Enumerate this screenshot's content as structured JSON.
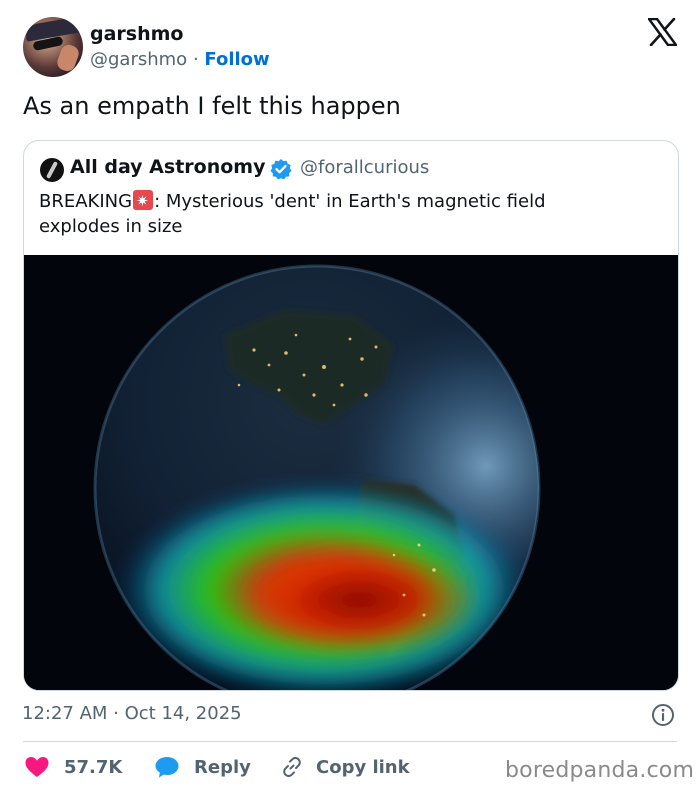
{
  "author": {
    "display_name": "garshmo",
    "handle": "@garshmo",
    "separator": "·",
    "follow_label": "Follow"
  },
  "tweet": {
    "text": "As an empath I felt this happen"
  },
  "quoted": {
    "display_name": "All day Astronomy",
    "handle": "@forallcurious",
    "text_prefix": "BREAKING",
    "text_line1_rest": ": Mysterious 'dent' in Earth's magnetic field",
    "text_line2": "explodes in size",
    "verified": true
  },
  "meta": {
    "timestamp": "12:27 AM · Oct 14, 2025"
  },
  "actions": {
    "like_count": "57.7K",
    "reply_label": "Reply",
    "copy_link_label": "Copy link"
  },
  "watermark": "boredpanda.com",
  "colors": {
    "link": "#006fd6",
    "like": "#f91880",
    "reply": "#1d9bf0",
    "verified": "#1d9bf0",
    "muted": "#536471"
  },
  "icons": {
    "x_logo": "x-logo-icon",
    "verified": "verified-badge-icon",
    "siren": "police-light-emoji-icon",
    "info": "info-icon",
    "like": "heart-icon",
    "reply": "speech-bubble-icon",
    "copy_link": "link-icon"
  }
}
